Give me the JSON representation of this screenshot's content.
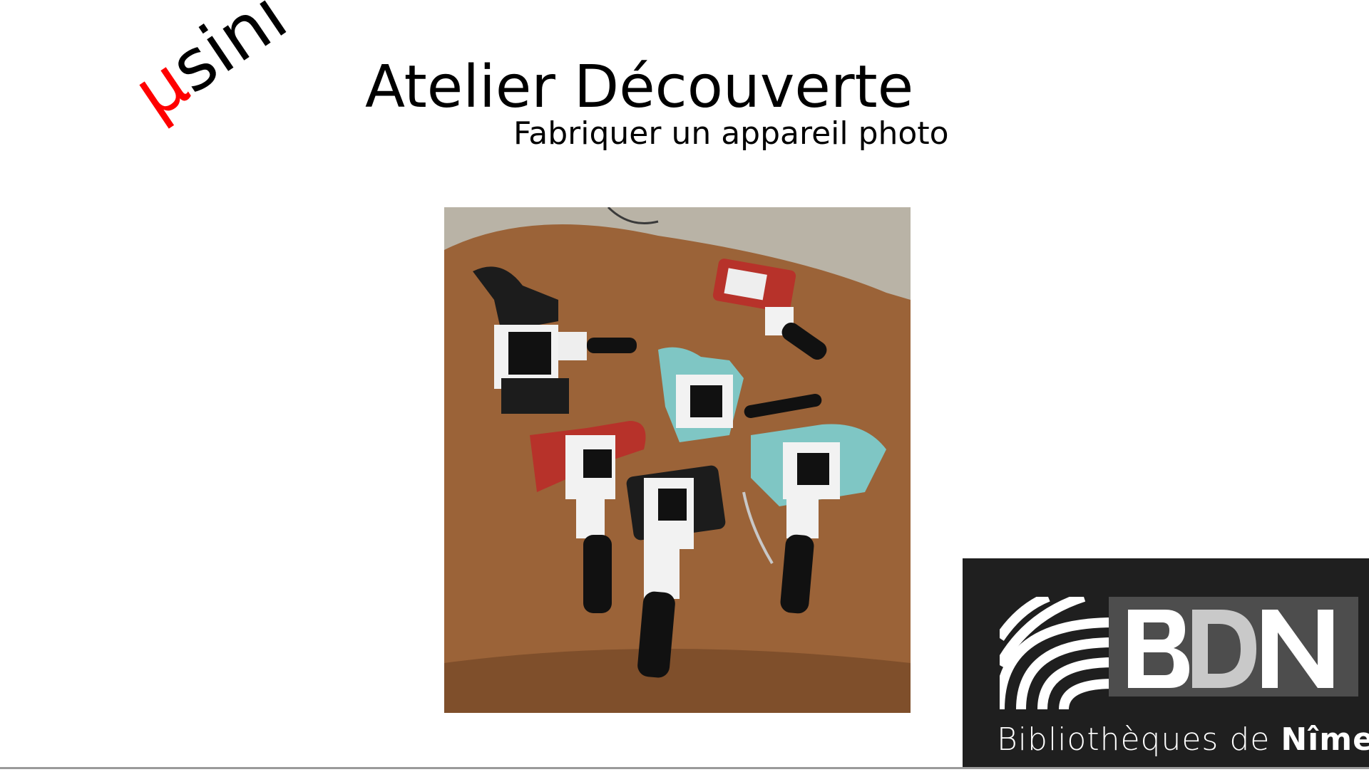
{
  "logo": {
    "mu": "µ",
    "rest": "sini",
    "mu_color": "#ff0000"
  },
  "title": "Atelier Découverte",
  "subtitle": "Fabriquer un appareil photo",
  "photo": {
    "subject": "cameras-photo"
  },
  "library_logo": {
    "letters": "BDN",
    "caption_prefix": "Bibliothèques de ",
    "caption_city": "Nîmes",
    "background": "#1f1f1f"
  }
}
